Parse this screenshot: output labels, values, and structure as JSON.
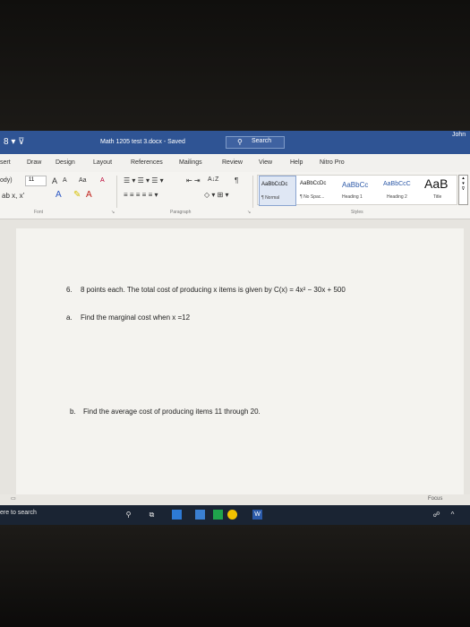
{
  "titlebar": {
    "quick_access": "8 ▾ ⊽",
    "document_title": "Math 1205 test 3.docx  -  Saved",
    "search_label": "Search",
    "user": "John"
  },
  "tabs": [
    "sert",
    "Draw",
    "Design",
    "Layout",
    "References",
    "Mailings",
    "Review",
    "View",
    "Help",
    "Nitro Pro"
  ],
  "ribbon": {
    "font_name": "ody)",
    "font_size": "11",
    "grow_font": "A",
    "shrink_font": "A",
    "change_case": "Aa",
    "clear_format": "A",
    "pilcrow": "¶",
    "sort": "A↓Z",
    "groups": {
      "font": "Font",
      "paragraph": "Paragraph",
      "styles": "Styles"
    }
  },
  "styles": [
    {
      "preview": "AaBbCcDc",
      "name": "¶ Normal",
      "selected": true
    },
    {
      "preview": "AaBbCcDc",
      "name": "¶ No Spac...",
      "selected": false
    },
    {
      "preview": "AaBbCc",
      "name": "Heading 1",
      "selected": false
    },
    {
      "preview": "AaBbCcC",
      "name": "Heading 2",
      "selected": false
    },
    {
      "preview": "AaB",
      "name": "Title",
      "selected": false
    }
  ],
  "document": {
    "question_number": "6.",
    "question_text": "8 points each. The total cost of producing x items is given by C(x) = 4x² − 30x + 500",
    "part_a_label": "a.",
    "part_a_text": "Find the marginal cost when x =12",
    "part_b_label": "b.",
    "part_b_text": "Find the average cost of producing items 11 through 20."
  },
  "status": {
    "focus": "Focus"
  },
  "taskbar": {
    "search_placeholder": "ere to search",
    "word_label": "W"
  },
  "colors": {
    "title_bar": "#2f5494",
    "taskbar": "#1a2433",
    "page": "#f4f3ef"
  }
}
